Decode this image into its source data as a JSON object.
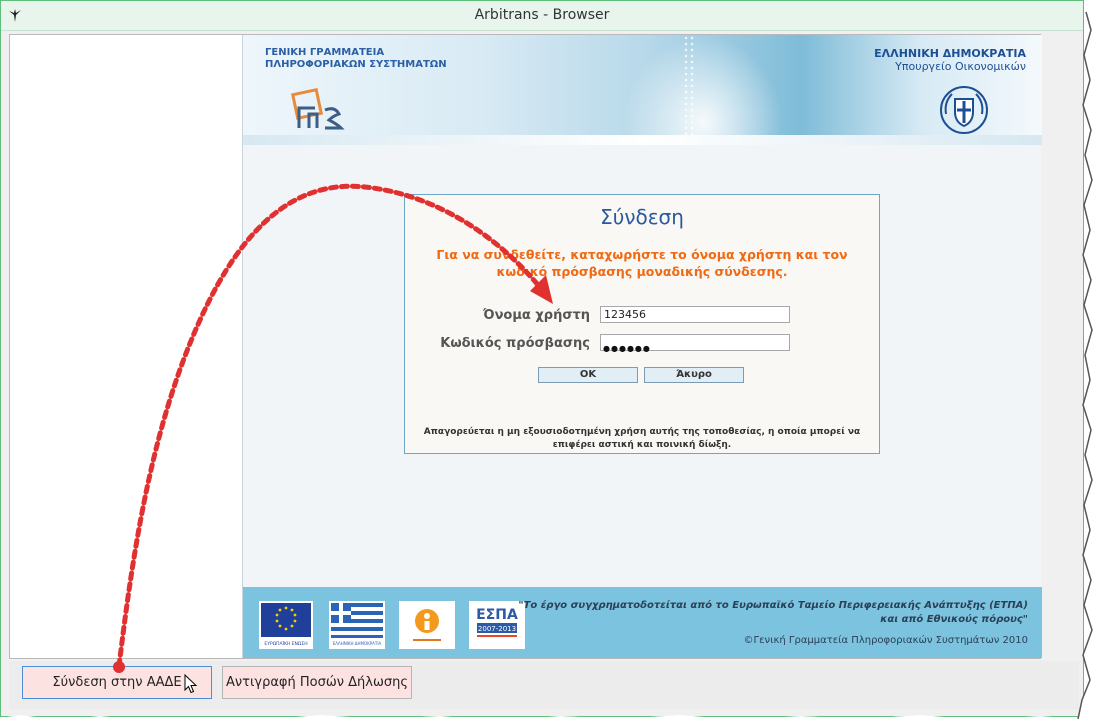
{
  "window": {
    "title": "Arbitrans - Browser"
  },
  "site": {
    "header": {
      "org_line1": "ΓΕΝΙΚΗ ΓΡΑΜΜΑΤΕΙΑ",
      "org_line2": "ΠΛΗΡΟΦΟΡΙΑΚΩΝ ΣΥΣΤΗΜΑΤΩΝ",
      "gov_line1": "ΕΛΛΗΝΙΚΗ ΔΗΜΟΚΡΑΤΙΑ",
      "gov_line2": "Υπουργείο Οικονομικών"
    },
    "login": {
      "title": "Σύνδεση",
      "instructions": "Για να συνδεθείτε, καταχωρήστε το όνομα χρήστη και τον κωδικό πρόσβασης μοναδικής σύνδεσης.",
      "username_label": "Όνομα χρήστη",
      "username_value": "123456",
      "password_label": "Κωδικός πρόσβασης",
      "password_mask": "●●●●●●",
      "ok_label": "ΟΚ",
      "cancel_label": "Άκυρο",
      "disclaimer": "Απαγορεύεται η μη εξουσιοδοτημένη χρήση αυτής της τοποθεσίας, η οποία μπορεί να επιφέρει αστική και ποινική δίωξη."
    },
    "footer": {
      "funding_line1": "\"Το έργο συγχρηματοδοτείται από το Ευρωπαϊκό Ταμείο Περιφερειακής Ανάπτυξης (ΕΤΠΑ)",
      "funding_line2": "και από Εθνικούς πόρους\"",
      "copyright": "©Γενική Γραμματεία Πληροφοριακών Συστημάτων 2010",
      "eu_label": "ΕΥΡΩΠΑΪΚΗ ΕΝΩΣΗ",
      "gr_label": "ΕΛΛΗΝΙΚΗ ΔΗΜΟΚΡΑΤΙΑ",
      "espa_label": "ΕΣΠΑ",
      "espa_years": "2007-2013"
    }
  },
  "bottom_bar": {
    "connect_button": "Σύνδεση στην ΑΑΔΕ",
    "copy_button": "Αντιγραφή Ποσών Δήλωσης"
  },
  "colors": {
    "accent_orange": "#f06a14",
    "title_blue": "#2a5a9e",
    "annotation_red": "#e03030",
    "footer_blue": "#7cc3df"
  }
}
